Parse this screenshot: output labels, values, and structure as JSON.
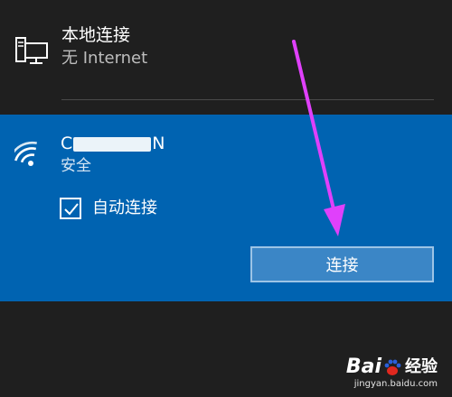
{
  "ethernet": {
    "title": "本地连接",
    "status": "无 Internet",
    "icon": "computer-network-icon"
  },
  "wifi": {
    "name_prefix": "C",
    "name_suffix": "N",
    "security": "安全",
    "icon": "wifi-signal-icon",
    "auto_connect_label": "自动连接",
    "auto_connect_checked": true,
    "connect_button_label": "连接"
  },
  "watermark": {
    "brand_pre": "Bai",
    "brand_post": "经验",
    "url": "jingyan.baidu.com"
  },
  "colors": {
    "background": "#1f1f1f",
    "selected": "#0063b1",
    "button": "#3b86c6",
    "arrow": "#e040fb"
  }
}
